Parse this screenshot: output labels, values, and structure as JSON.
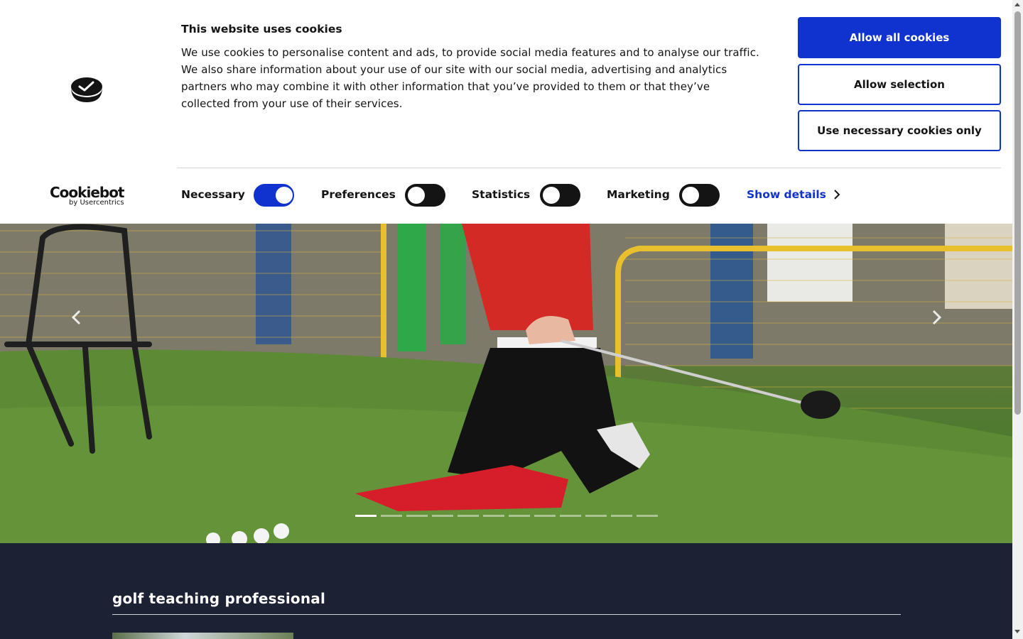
{
  "cookie_banner": {
    "title": "This website uses cookies",
    "body": "We use cookies to personalise content and ads, to provide social media features and to analyse our traffic. We also share information about your use of our site with our social media, advertising and analytics partners who may combine it with other information that you’ve provided to them or that they’ve collected from your use of their services.",
    "buttons": {
      "allow_all": "Allow all cookies",
      "allow_selection": "Allow selection",
      "necessary_only": "Use necessary cookies only"
    },
    "toggles": [
      {
        "label": "Necessary",
        "on": true
      },
      {
        "label": "Preferences",
        "on": false
      },
      {
        "label": "Statistics",
        "on": false
      },
      {
        "label": "Marketing",
        "on": false
      }
    ],
    "show_details": "Show details",
    "brand": {
      "name": "Cookiebot",
      "by": "by Usercentrics"
    },
    "colors": {
      "accent": "#1032cf",
      "toggle_off": "#141414"
    }
  },
  "hero": {
    "icons": {
      "prev": "chevron-left-icon",
      "next": "chevron-right-icon"
    },
    "slide_count": 12,
    "active_slide": 1
  },
  "content": {
    "section_title": "golf teaching professional",
    "background": "#1c2233"
  }
}
